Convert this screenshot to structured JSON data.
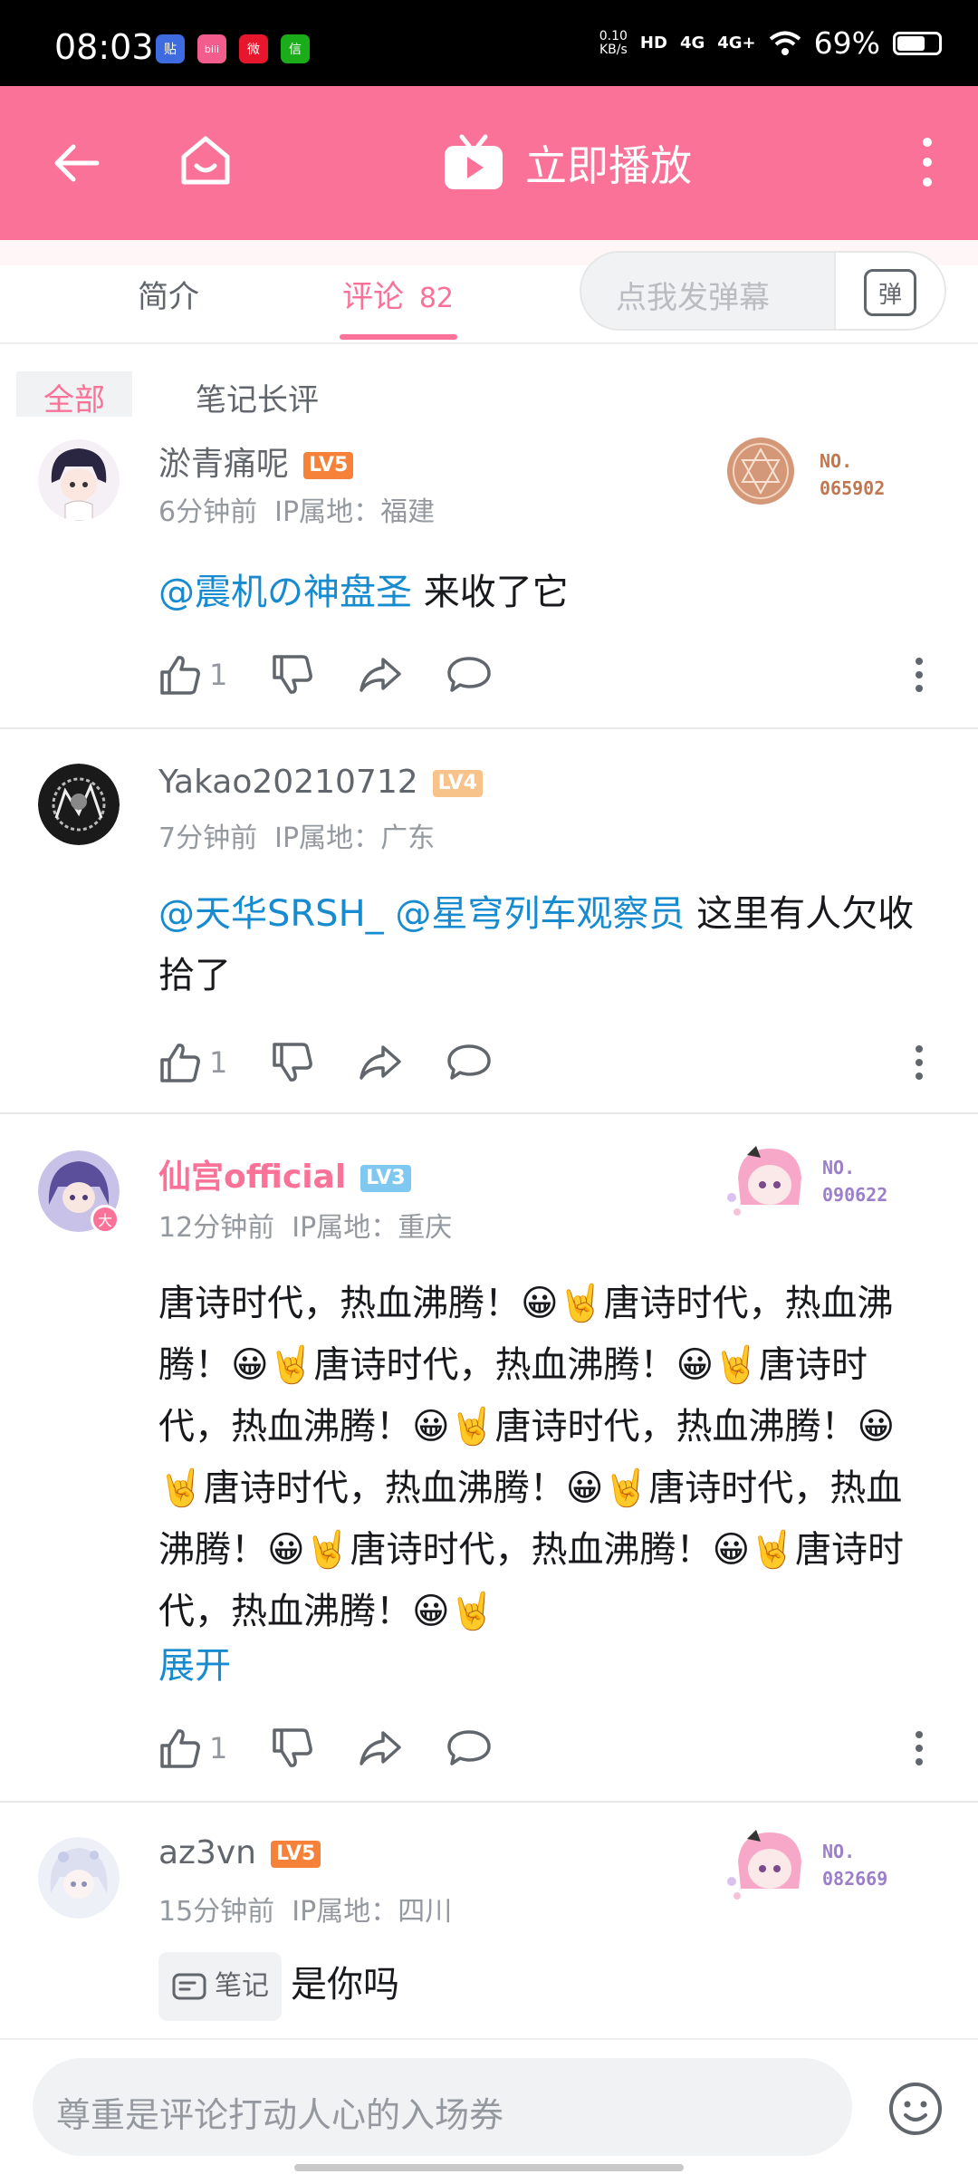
{
  "status_bar": {
    "time": "08:03",
    "apps": [
      {
        "label": "贴",
        "color": "#3f6be0"
      },
      {
        "label": "bili",
        "color": "#f25d8e"
      },
      {
        "label": "微",
        "color": "#e6162d"
      },
      {
        "label": "信",
        "color": "#1aad19"
      }
    ],
    "net_speed_top": "0.10",
    "net_speed_bottom": "KB/s",
    "hd": "HD",
    "net1": "4G",
    "net2": "4G+",
    "battery": "69%",
    "battery_level": 0.69
  },
  "app_bar": {
    "play_label": "立即播放",
    "color": "#fb7299"
  },
  "tabs": {
    "intro": "简介",
    "comments": "评论",
    "comment_count": "82"
  },
  "danmaku": {
    "placeholder": "点我发弹幕",
    "button_label": "弹"
  },
  "filters": {
    "all": "全部",
    "notes": "笔记长评"
  },
  "comments": [
    {
      "username": "淤青痛呢",
      "level": "LV5",
      "level_color": "#f6823a",
      "time": "6分钟前",
      "ip": "IP属地：福建",
      "mention": "@震机の神盘圣",
      "text": " 来收了它",
      "likes": "1",
      "fan_no_line1": "NO.",
      "fan_no_line2": "065902",
      "fan_color": "#c07850"
    },
    {
      "username": "Yakao20210712",
      "level": "LV4",
      "level_color": "#f8c38b",
      "time": "7分钟前",
      "ip": "IP属地：广东",
      "mention": "@天华SRSH_ @星穹列车观察员",
      "text": " 这里有人欠收拾了",
      "likes": "1"
    },
    {
      "username": "仙宫official",
      "level": "LV3",
      "level_color": "#7fc8f0",
      "time": "12分钟前",
      "ip": "IP属地：重庆",
      "text": "唐诗时代，热血沸腾！😀🤘唐诗时代，热血沸腾！😀🤘唐诗时代，热血沸腾！😀🤘唐诗时代，热血沸腾！😀🤘唐诗时代，热血沸腾！😀🤘唐诗时代，热血沸腾！😀🤘唐诗时代，热血沸腾！😀🤘唐诗时代，热血沸腾！😀🤘唐诗时代，热血沸腾！😀🤘",
      "expand": "展开",
      "likes": "1",
      "fan_no_line1": "NO.",
      "fan_no_line2": "090622",
      "fan_color": "#9b7fc8"
    },
    {
      "username": "az3vn",
      "level": "LV5",
      "level_color": "#f6823a",
      "time": "15分钟前",
      "ip": "IP属地：四川",
      "note_badge": "笔记",
      "text": "是你吗",
      "fan_no_line1": "NO.",
      "fan_no_line2": "082669",
      "fan_color": "#9b7fc8"
    }
  ],
  "reply_bar": {
    "placeholder": "尊重是评论打动人心的入场券"
  }
}
